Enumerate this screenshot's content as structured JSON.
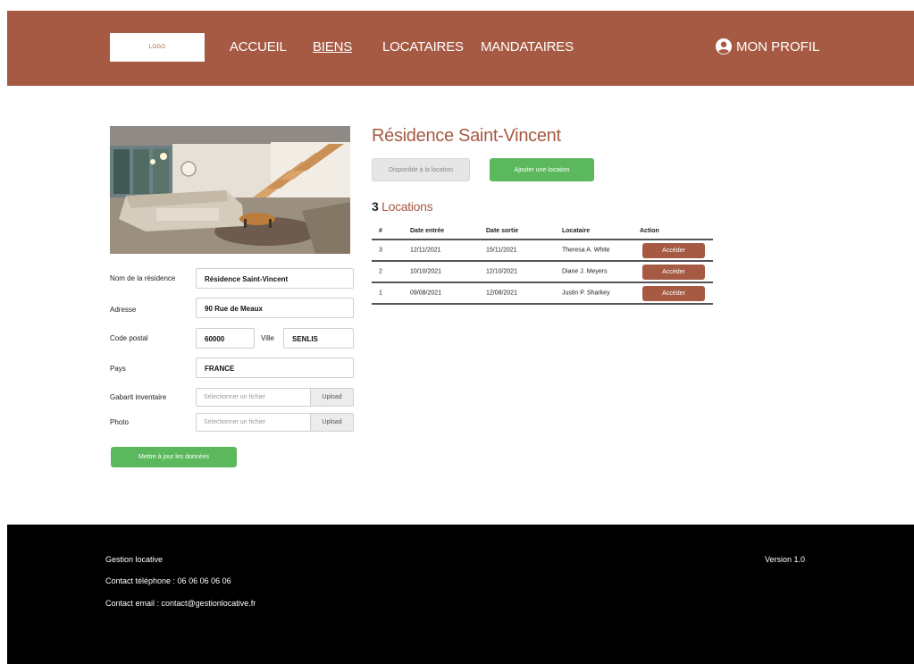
{
  "header": {
    "logo_text": "LOGO",
    "nav": [
      "ACCUEIL",
      "BIENS",
      "LOCATAIRES",
      "MANDATAIRES"
    ],
    "active_nav": "BIENS",
    "profile_label": "MON PROFIL",
    "profile_icon": "user-circle-icon"
  },
  "property": {
    "title": "Résidence Saint-Vincent",
    "status_button": "Disponible à la location",
    "add_rental_button": "Ajouter une location",
    "locations_count": "3",
    "locations_label": "Locations"
  },
  "table": {
    "headers": [
      "#",
      "Date entrée",
      "Date sortie",
      "Locataire",
      "Action"
    ],
    "rows": [
      {
        "num": "3",
        "date_in": "12/11/2021",
        "date_out": "15/11/2021",
        "tenant": "Theresa A. White",
        "action": "Accéder"
      },
      {
        "num": "2",
        "date_in": "10/10/2021",
        "date_out": "12/10/2021",
        "tenant": "Diane J. Meyers",
        "action": "Accéder"
      },
      {
        "num": "1",
        "date_in": "09/08/2021",
        "date_out": "12/08/2021",
        "tenant": "Justin P. Sharkey",
        "action": "Accéder"
      }
    ]
  },
  "form": {
    "name_label": "Nom de la résidence",
    "name_value": "Résidence Saint-Vincent",
    "address_label": "Adresse",
    "address_value": "90 Rue de Meaux",
    "postal_label": "Code postal",
    "postal_value": "60000",
    "city_label": "Ville",
    "city_value": "SENLIS",
    "country_label": "Pays",
    "country_value": "FRANCE",
    "template_label": "Gabarit inventaire",
    "photo_label": "Photo",
    "file_placeholder": "Sélectionner un fichier",
    "upload_label": "Upload",
    "submit_label": "Mettre à jour les données"
  },
  "footer": {
    "app_name": "Gestion locative",
    "phone": "Contact téléphone : 06 06 06 06 06",
    "email": "Contact email : contact@gestionlocative.fr",
    "version": "Version 1.0"
  },
  "colors": {
    "brand": "#a65a43",
    "green": "#5cb85c",
    "footer_bg": "#000000"
  }
}
